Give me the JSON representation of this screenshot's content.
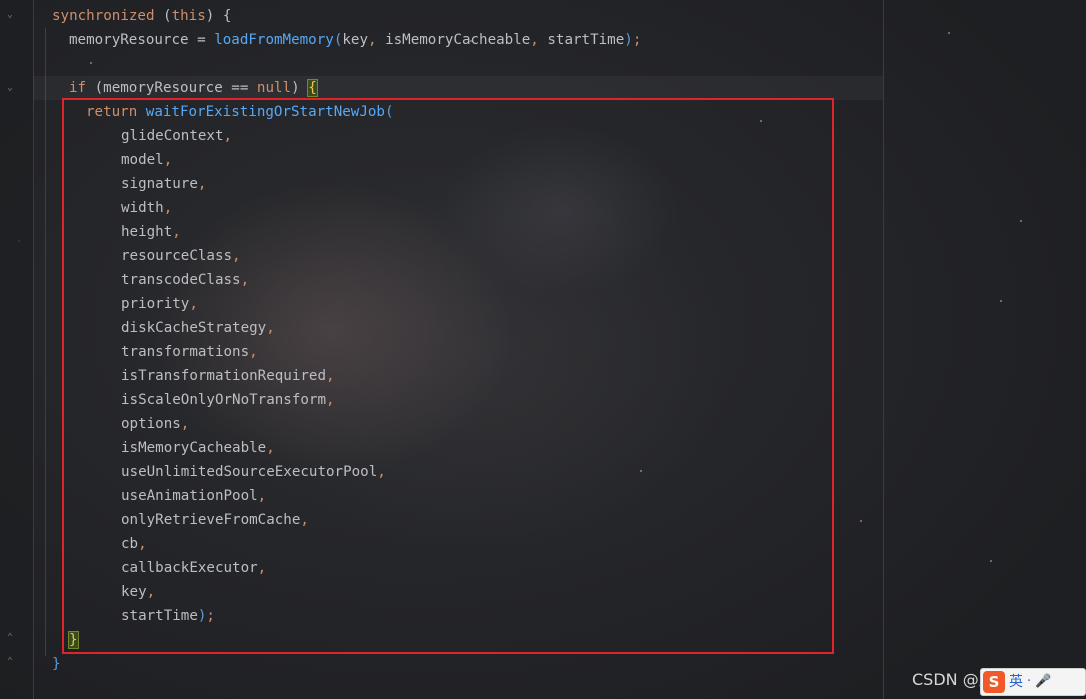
{
  "editor": {
    "lines": [
      {
        "id": "sync",
        "segments": [
          {
            "cls": "kw",
            "text": "synchronized "
          },
          {
            "cls": "brace",
            "text": "("
          },
          {
            "cls": "kw",
            "text": "this"
          },
          {
            "cls": "brace",
            "text": ") "
          },
          {
            "cls": "brace",
            "text": "{"
          }
        ]
      },
      {
        "id": "assign",
        "segments": [
          {
            "cls": "",
            "text": "memoryResource = "
          },
          {
            "cls": "fn",
            "text": "loadFromMemory"
          },
          {
            "cls": "paren",
            "text": "("
          },
          {
            "cls": "",
            "text": "key"
          },
          {
            "cls": "punct",
            "text": ", "
          },
          {
            "cls": "",
            "text": "isMemoryCacheable"
          },
          {
            "cls": "punct",
            "text": ", "
          },
          {
            "cls": "",
            "text": "startTime"
          },
          {
            "cls": "paren",
            "text": ")"
          },
          {
            "cls": "punct",
            "text": ";"
          }
        ]
      },
      {
        "id": "if",
        "segments": [
          {
            "cls": "kw",
            "text": "if "
          },
          {
            "cls": "brace",
            "text": "("
          },
          {
            "cls": "",
            "text": "memoryResource == "
          },
          {
            "cls": "kw",
            "text": "null"
          },
          {
            "cls": "brace",
            "text": ") "
          },
          {
            "cls": "brace-hl",
            "text": "{"
          }
        ]
      },
      {
        "id": "return",
        "segments": [
          {
            "cls": "kw",
            "text": "return "
          },
          {
            "cls": "fn",
            "text": "waitForExistingOrStartNewJob"
          },
          {
            "cls": "paren",
            "text": "("
          }
        ]
      }
    ],
    "args": [
      "glideContext",
      "model",
      "signature",
      "width",
      "height",
      "resourceClass",
      "transcodeClass",
      "priority",
      "diskCacheStrategy",
      "transformations",
      "isTransformationRequired",
      "isScaleOnlyOrNoTransform",
      "options",
      "isMemoryCacheable",
      "useUnlimitedSourceExecutorPool",
      "useAnimationPool",
      "onlyRetrieveFromCache",
      "cb",
      "callbackExecutor",
      "key"
    ],
    "last_arg": "startTime",
    "last_arg_close": ")",
    "last_arg_end": ";",
    "arg_separator": ",",
    "if_close": "}",
    "sync_close": "}"
  },
  "watermark": {
    "text": "CSDN @风掠云涌"
  },
  "ime": {
    "logo": "S",
    "mode": "英",
    "punct": "·",
    "mic": "🎤"
  },
  "colors": {
    "keyword": "#cf8e6d",
    "function": "#56a8f5",
    "text": "#bcbec4",
    "selection_border": "#e0242b"
  }
}
